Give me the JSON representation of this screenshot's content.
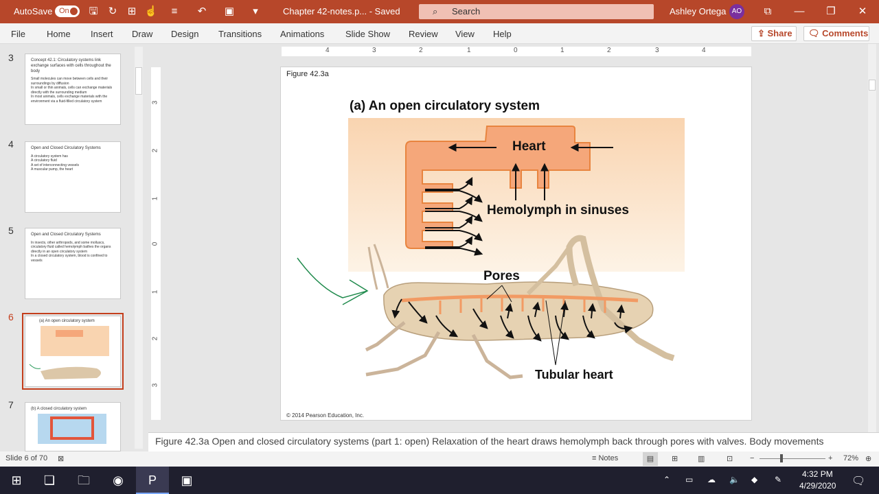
{
  "titlebar": {
    "autosave_label": "AutoSave",
    "autosave_state": "On",
    "doc_title": "Chapter 42-notes.p...  -  Saved",
    "search_placeholder": "Search",
    "user_name": "Ashley Ortega",
    "user_initials": "AO"
  },
  "menu": {
    "items": [
      "File",
      "Home",
      "Insert",
      "Draw",
      "Design",
      "Transitions",
      "Animations",
      "Slide Show",
      "Review",
      "View",
      "Help"
    ],
    "share_label": "Share",
    "comments_label": "Comments"
  },
  "thumbnails": [
    {
      "num": "3",
      "title": "Concept 42.1: Circulatory systems link exchange surfaces with cells throughout the body",
      "lines": [
        "Small molecules can move between cells and their surroundings by diffusion",
        "In small or thin animals, cells can exchange materials directly with the surrounding medium",
        "In most animals, cells exchange materials with the environment via a fluid-filled circulatory system"
      ]
    },
    {
      "num": "4",
      "title": "Open and Closed Circulatory Systems",
      "lines": [
        "A circulatory system has",
        "A circulatory fluid",
        "A set of interconnecting vessels",
        "A muscular pump, the heart"
      ]
    },
    {
      "num": "5",
      "title": "Open and Closed Circulatory Systems",
      "lines": [
        "In insects, other arthropods, and some molluscs, circulatory fluid called hemolymph bathes the organs directly in an open circulatory system",
        "In a closed circulatory system, blood is confined to vessels"
      ]
    },
    {
      "num": "6",
      "title": "(a) An open circulatory system",
      "lines": []
    },
    {
      "num": "7",
      "title": "(b) A closed circulatory system",
      "lines": []
    }
  ],
  "slide": {
    "figure_label": "Figure 42.3a",
    "heading": "(a) An open circulatory system",
    "label_heart": "Heart",
    "label_hemolymph": "Hemolymph in sinuses",
    "label_pores": "Pores",
    "label_tubular": "Tubular heart",
    "copyright": "© 2014 Pearson Education, Inc."
  },
  "ruler": {
    "h_ticks": [
      "4",
      "3",
      "2",
      "1",
      "0",
      "1",
      "2",
      "3",
      "4"
    ],
    "v_ticks": [
      "3",
      "2",
      "1",
      "0",
      "1",
      "2",
      "3"
    ]
  },
  "notes_text": "Figure 42.3a Open and closed circulatory systems (part 1: open) Relaxation of the heart draws hemolymph back through pores with valves. Body movements circulate hemolymph.",
  "status": {
    "slide_counter": "Slide 6 of 70",
    "notes_label": "Notes",
    "zoom": "72%"
  },
  "taskbar": {
    "time": "4:32 PM",
    "date": "4/29/2020"
  },
  "colors": {
    "brand": "#b7472a",
    "heart_fill": "#f5a77a",
    "heart_stroke": "#e8843f",
    "panel_top": "#f9d4b0",
    "panel_bottom": "#fdf3e6"
  }
}
